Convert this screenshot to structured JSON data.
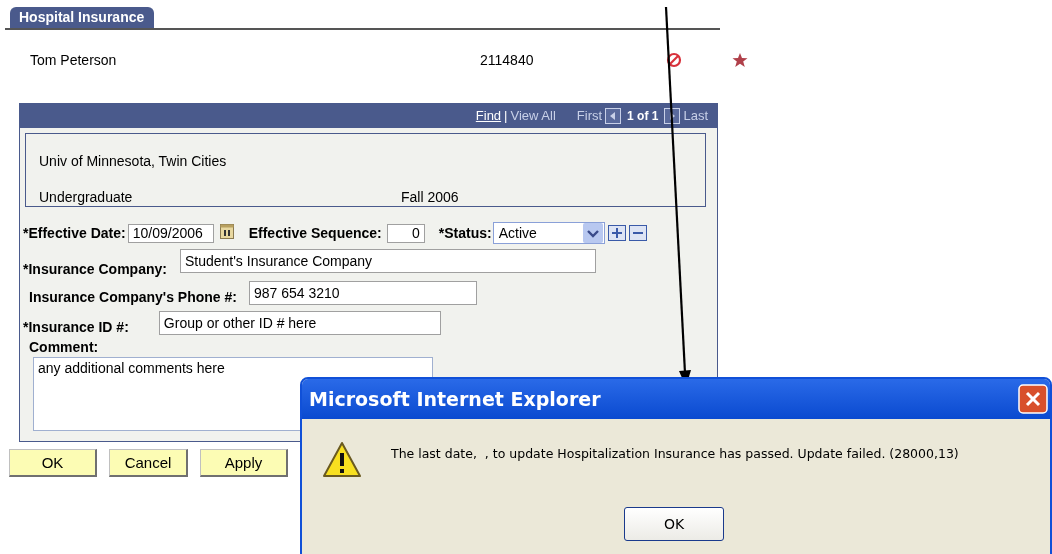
{
  "tabs": [
    {
      "label": "Hospital Insurance",
      "selected": true
    }
  ],
  "person": {
    "name": "Tom Peterson",
    "id": "2114840"
  },
  "grid": {
    "find": "Find",
    "separator": "|",
    "view_all": "View All",
    "first": "First",
    "position": "1 of 1",
    "last": "Last"
  },
  "institution": {
    "campus": "Univ of Minnesota, Twin Cities",
    "career": "Undergraduate",
    "term": "Fall 2006"
  },
  "form": {
    "effective_date": {
      "label": "*Effective Date:",
      "value": "10/09/2006"
    },
    "effective_sequence": {
      "label": "Effective Sequence:",
      "value": "0"
    },
    "status": {
      "label": "*Status:",
      "value": "Active"
    },
    "insurance_company": {
      "label": "*Insurance Company:",
      "value": "Student's Insurance Company"
    },
    "phone": {
      "label": "Insurance Company's Phone #:",
      "value": "987 654 3210"
    },
    "insurance_id": {
      "label": "*Insurance ID #:",
      "value": "Group or other ID # here"
    },
    "comment": {
      "label": "Comment:",
      "value": "any additional comments here"
    }
  },
  "buttons": [
    "OK",
    "Cancel",
    "Apply"
  ],
  "dialog": {
    "title": "Microsoft Internet Explorer",
    "message": "The last date,  , to update Hospitalization Insurance has passed. Update failed. (28000,13)",
    "button": "OK"
  }
}
